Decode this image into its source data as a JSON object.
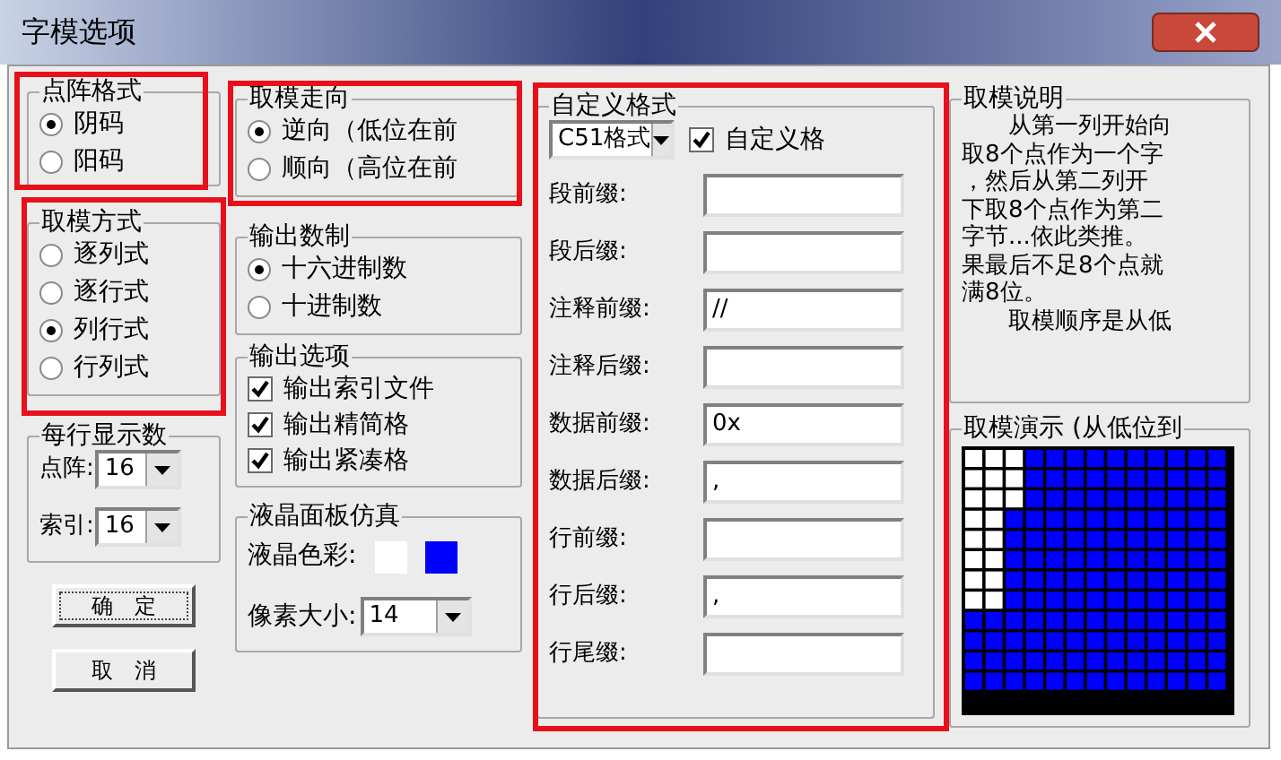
{
  "window": {
    "title": "字模选项"
  },
  "dot_format": {
    "title": "点阵格式",
    "options": [
      {
        "label": "阴码",
        "selected": true
      },
      {
        "label": "阳码",
        "selected": false
      }
    ]
  },
  "scan_mode": {
    "title": "取模方式",
    "options": [
      {
        "label": "逐列式",
        "selected": false
      },
      {
        "label": "逐行式",
        "selected": false
      },
      {
        "label": "列行式",
        "selected": true
      },
      {
        "label": "行列式",
        "selected": false
      }
    ]
  },
  "per_line": {
    "title": "每行显示数",
    "fields": [
      {
        "label": "点阵:",
        "value": "16"
      },
      {
        "label": "索引:",
        "value": "16"
      }
    ]
  },
  "buttons": [
    "确　定",
    "取　消"
  ],
  "direction": {
    "title": "取模走向",
    "options": [
      {
        "label": "逆向（低位在前",
        "selected": true
      },
      {
        "label": "顺向（高位在前",
        "selected": false
      }
    ]
  },
  "radix": {
    "title": "输出数制",
    "options": [
      {
        "label": "十六进制数",
        "selected": true
      },
      {
        "label": "十进制数",
        "selected": false
      }
    ]
  },
  "output_options": {
    "title": "输出选项",
    "items": [
      {
        "label": "输出索引文件",
        "checked": true
      },
      {
        "label": "输出精简格",
        "checked": true
      },
      {
        "label": "输出紧凑格",
        "checked": true
      }
    ]
  },
  "lcd": {
    "title": "液晶面板仿真",
    "color_label": "液晶色彩:",
    "swatches": [
      {
        "color": "#ffffff"
      },
      {
        "color": "#0000ff"
      }
    ],
    "size_label": "像素大小:",
    "size_value": "14"
  },
  "custom": {
    "title": "自定义格式",
    "format": "C51格式",
    "custom_checkbox": {
      "label": "自定义格",
      "checked": true
    },
    "fields": [
      {
        "label": "段前缀:"
      },
      {
        "label": "段后缀:"
      },
      {
        "label": "注释前缀:",
        "value": "//"
      },
      {
        "label": "注释后缀:"
      },
      {
        "label": "数据前缀:",
        "value": "0x"
      },
      {
        "label": "数据后缀:",
        "value": ","
      },
      {
        "label": "行前缀:"
      },
      {
        "label": "行后缀:",
        "value": ","
      },
      {
        "label": "行尾缀:"
      }
    ]
  },
  "description": {
    "title": "取模说明",
    "lines": [
      "从第一列开始向",
      "取8个点作为一个字",
      "，然后从第二列开",
      "下取8个点作为第二",
      "字节...依此类推。",
      "果最后不足8个点就",
      "满8位。",
      "取模顺序是从低"
    ]
  },
  "demo": {
    "title": "取模演示 (从低位到"
  }
}
